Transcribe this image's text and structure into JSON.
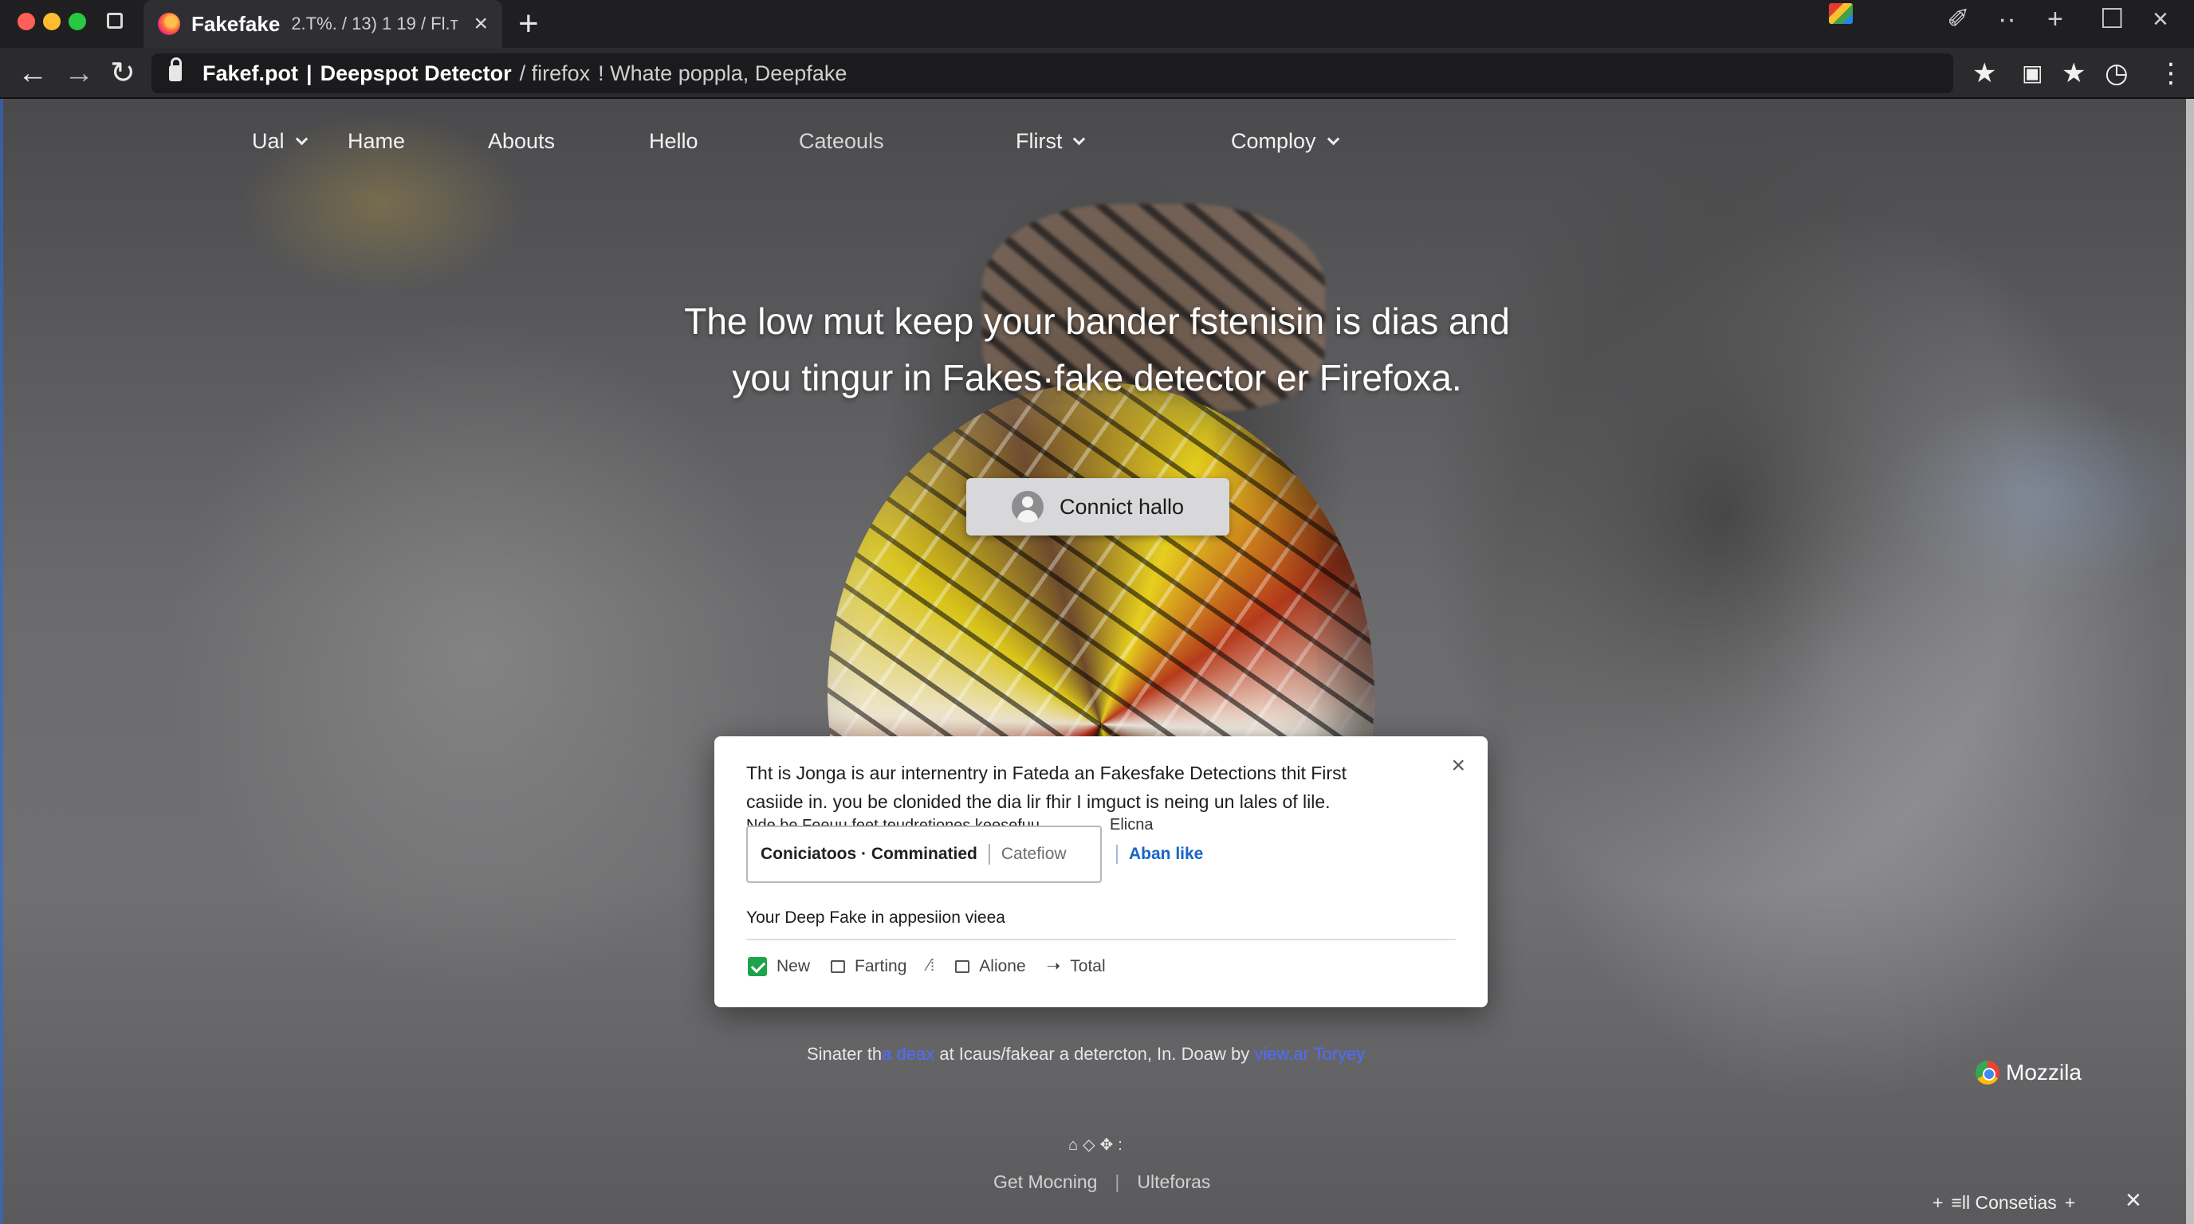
{
  "browser": {
    "tab": {
      "title": "Fakefake",
      "subtitle": "2.T%. / 13)    1 19 / Fl.т"
    },
    "url": {
      "domain": "Fakef.pot",
      "separator": "|",
      "site": "Deepspot Detector",
      "path": "/ firefox",
      "rest": "! Whate poppla, Deepfake"
    }
  },
  "menu": {
    "items": [
      "Ual",
      "Hame",
      "Abouts",
      "Hello",
      "Cateouls",
      "Flirst",
      "Comploy"
    ]
  },
  "hero": {
    "line1": "The low mut keep your bander fstenisin is dias and",
    "line2": "you tingur in Fakes·fake detector er Firefoxa.",
    "cta_label": "Connict hallo"
  },
  "card": {
    "line1": "Tht is Jonga is aur internentry in Fateda an Fakesfake Detections thit First",
    "line2": "casiide in. you be clonided the dia lir fhir I imguct is neing un lales of lile.",
    "ghost": "Nde be Feeuu feet teudretiones keesefuu",
    "label": "Elicna",
    "segment_active": "Coniciatoos · Comminatied",
    "segment_other": "Catefiow",
    "link": "Aban like",
    "subtitle": "Your Deep Fake in appesiion vieea",
    "options": {
      "new": "New",
      "farting": "Farting",
      "alione": "Alione",
      "total": "Total"
    },
    "accent": "#1fa34a"
  },
  "footer": {
    "line_pre": "Sinater th",
    "line_link1": "a deax",
    "line_mid": " at Icaus/fakear a detercton, In. Doaw by ",
    "line_link2": "view.ar Toryey",
    "link_left": "Get Mocning",
    "link_sep": "|",
    "link_right": "Ulteforas",
    "brand": "Mozzila",
    "bottom_right": "≡ll Consetias"
  }
}
